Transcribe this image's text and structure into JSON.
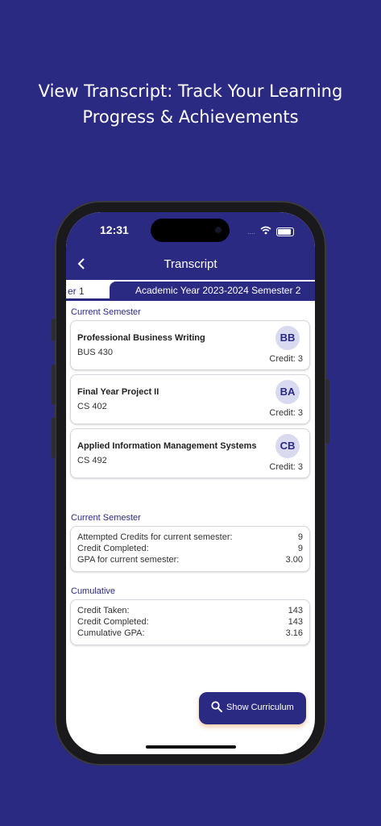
{
  "headline": {
    "line1": "View Transcript: Track Your Learning",
    "line2": "Progress & Achievements"
  },
  "status_bar": {
    "time": "12:31",
    "signal": "....",
    "icons": [
      "wifi-icon",
      "battery-icon"
    ]
  },
  "app_bar": {
    "title": "Transcript",
    "back_icon": "chevron-left-icon"
  },
  "tabs": [
    {
      "label": "er 1",
      "active": false
    },
    {
      "label": "Academic Year 2023-2024 Semester 2",
      "active": true
    }
  ],
  "courses_section": {
    "label": "Current Semester",
    "courses": [
      {
        "name": "Professional Business Writing",
        "code": "BUS 430",
        "grade": "BB",
        "credit": "Credit: 3"
      },
      {
        "name": "Final Year Project II",
        "code": "CS 402",
        "grade": "BA",
        "credit": "Credit: 3"
      },
      {
        "name": "Applied Information Management Systems",
        "code": "CS 492",
        "grade": "CB",
        "credit": "Credit: 3"
      }
    ]
  },
  "semester_summary": {
    "label": "Current Semester",
    "rows": [
      {
        "label": "Attempted Credits for current semester:",
        "value": "9"
      },
      {
        "label": "Credit Completed:",
        "value": "9"
      },
      {
        "label": "GPA for current semester:",
        "value": "3.00"
      }
    ]
  },
  "cumulative_summary": {
    "label": "Cumulative",
    "rows": [
      {
        "label": "Credit Taken:",
        "value": "143"
      },
      {
        "label": "Credit Completed:",
        "value": "143"
      },
      {
        "label": "Cumulative GPA:",
        "value": "3.16"
      }
    ]
  },
  "fab": {
    "label": "Show Curriculum",
    "icon": "search-icon"
  },
  "colors": {
    "primary": "#2b2a83",
    "background": "#2b2a83",
    "grade_badge": "#d9d9f0",
    "fab_shadow": "#e69650"
  }
}
